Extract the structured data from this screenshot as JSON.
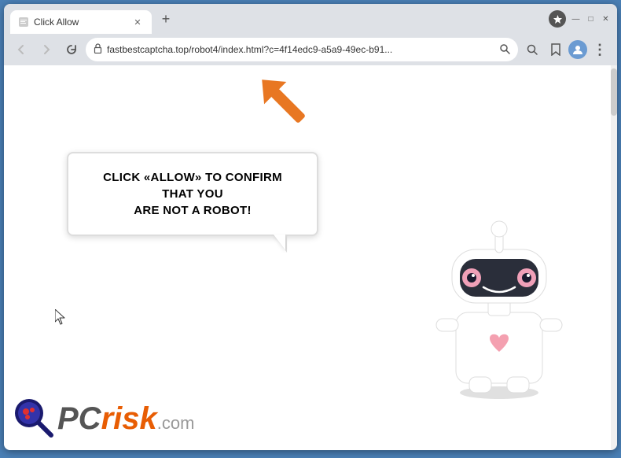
{
  "browser": {
    "title": "Click Allow",
    "tab": {
      "label": "Click Allow",
      "favicon": "page-icon"
    },
    "new_tab_label": "+",
    "window_controls": {
      "minimize": "—",
      "maximize": "□",
      "close": "✕"
    },
    "nav": {
      "back": "←",
      "forward": "→",
      "reload": "✕"
    },
    "address": {
      "url": "fastbestcaptcha.top/robot4/index.html?c=4f14edc9-a5a9-49ec-b91...",
      "lock": "🔒"
    },
    "toolbar_icons": {
      "search": "🔍",
      "bookmark": "☆",
      "profile": "👤",
      "menu": "⋮",
      "extension": "⬇"
    }
  },
  "page": {
    "bubble_text_line1": "CLICK «ALLOW» TO CONFIRM THAT YOU",
    "bubble_text_line2": "ARE NOT A ROBOT!",
    "bubble_combined": "CLICK «ALLOW» TO CONFIRM THAT YOU ARE NOT A ROBOT!",
    "arrow_direction": "upper-right",
    "robot_alt": "cartoon robot character"
  },
  "logo": {
    "pc": "PC",
    "risk": "risk",
    "dot_com": ".com"
  },
  "colors": {
    "orange_arrow": "#e87722",
    "orange_risk": "#e85d04",
    "bubble_border": "#dddddd",
    "browser_bg": "#dee1e6",
    "accent_blue": "#4a7fb5"
  }
}
